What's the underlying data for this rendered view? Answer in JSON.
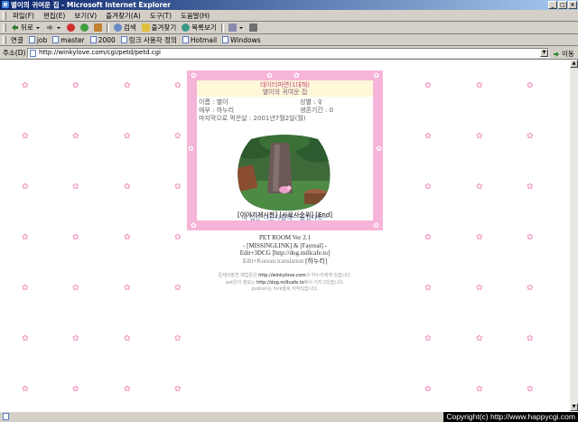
{
  "window": {
    "title": "별이의 귀여운 집 - Microsoft Internet Explorer",
    "ie_icon": "e",
    "controls": [
      "_",
      "□",
      "×"
    ]
  },
  "menu": [
    "파일(F)",
    "편집(E)",
    "보기(V)",
    "즐겨찾기(A)",
    "도구(T)",
    "도움말(H)"
  ],
  "toolbar": {
    "back": "뒤로",
    "search": "검색",
    "favorites": "즐겨찾기",
    "history": "목록보기"
  },
  "links": {
    "label": "연결",
    "items": [
      "job",
      "master",
      "2000",
      "링크 사용자 정의",
      "Hotmail",
      "Windows"
    ]
  },
  "address": {
    "label": "주소(D)",
    "url": "http://winkylove.com/cgi/petd/petd.cgi",
    "go": "이동"
  },
  "pet": {
    "header_line1": "데이터파면(1대해)",
    "header_line2": "별이의 귀여운 집",
    "name_label": "이름 : 별이",
    "gender_label": "성별 : ♀",
    "owner_label": "애부 : 하누리",
    "life_label": "생존기간 : 0",
    "last_fed_label": "마지막으로 먹은날 : 2001년7월2일(월)",
    "message": "나 집안 나간다들해~ 즐있다와~",
    "link_board": "[이야기게시판]",
    "link_feed": "[사육사순위]",
    "link_end": "[End]"
  },
  "credits": {
    "line1": "PET ROOM Ver 2.1",
    "line2": "- [MISSINGLINK] & [Fayreal] -",
    "line3": "Edit+3DCG [http://dog.millcafe.to]",
    "line4a": "Edit+Korean translation ",
    "line4b": "[하누리]"
  },
  "notes": {
    "n1a": "문제의발견 패업문은 ",
    "n1b": "http://winkylove.com",
    "n1c": "과 하누리에게 있습니다.",
    "n2a": "pet은의 정보는 ",
    "n2b": "http://dog.millcafe.to",
    "n2c": "에서 가지고있습니다.",
    "n3": "publish는 fork들로 저작있습니다."
  },
  "status": {
    "copyright": "Copyright(c) http://www.happycgi.com"
  },
  "colors": {
    "frame_pink": "#f6b4d8",
    "bow_pink": "#f2a0c6",
    "header_bg": "#fff8d8",
    "titlebar": "#0a246a"
  }
}
